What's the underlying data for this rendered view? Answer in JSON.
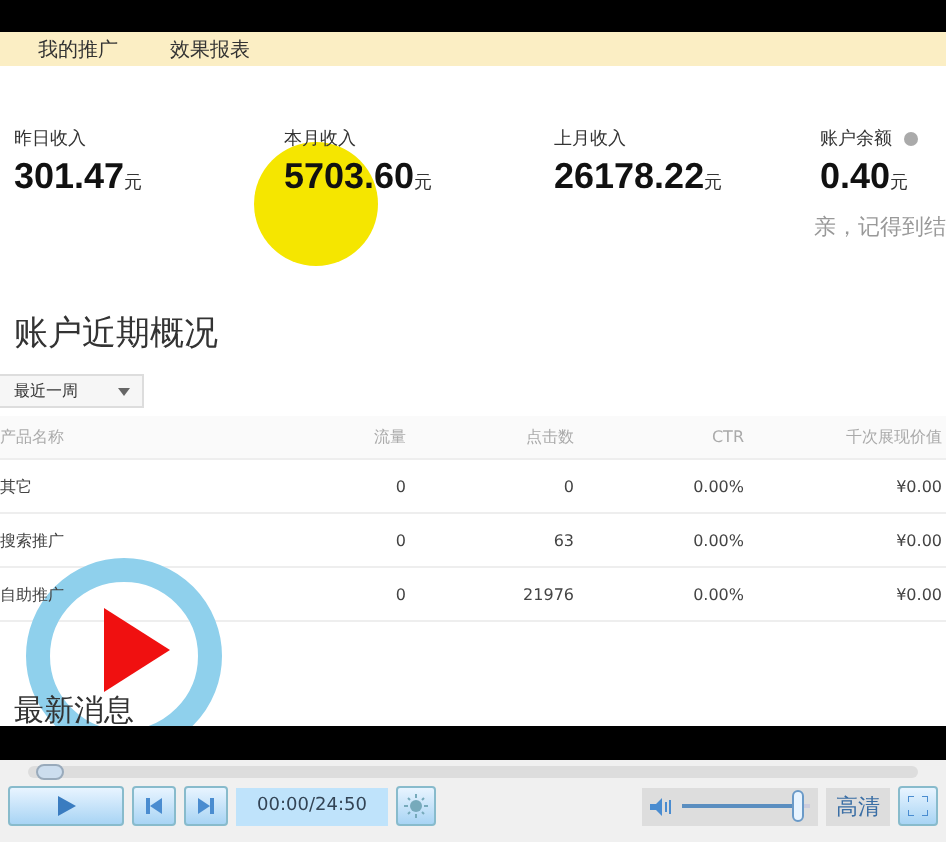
{
  "page": {
    "tabs": [
      {
        "label": "我的推广"
      },
      {
        "label": "效果报表"
      }
    ],
    "stats": [
      {
        "label": "昨日收入",
        "value": "301.47",
        "unit": "元"
      },
      {
        "label": "本月收入",
        "value": "5703.60",
        "unit": "元"
      },
      {
        "label": "上月收入",
        "value": "26178.22",
        "unit": "元"
      },
      {
        "label": "账户余额",
        "value": "0.40",
        "unit": "元",
        "help": true
      }
    ],
    "note": "亲，记得到结",
    "overview_title": "账户近期概况",
    "period_select": "最近一周",
    "table": {
      "columns": [
        "产品名称",
        "流量",
        "点击数",
        "CTR",
        "千次展现价值"
      ],
      "rows": [
        [
          "其它",
          "0",
          "0",
          "0.00%",
          "¥0.00"
        ],
        [
          "搜索推广",
          "0",
          "63",
          "0.00%",
          "¥0.00"
        ],
        [
          "自助推广",
          "0",
          "21976",
          "0.00%",
          "¥0.00"
        ]
      ]
    },
    "news_title": "最新消息"
  },
  "player": {
    "seek": {
      "level": 0.01
    },
    "time": "00:00/24:50",
    "volume": {
      "level": 0.9
    },
    "quality": "高清"
  }
}
